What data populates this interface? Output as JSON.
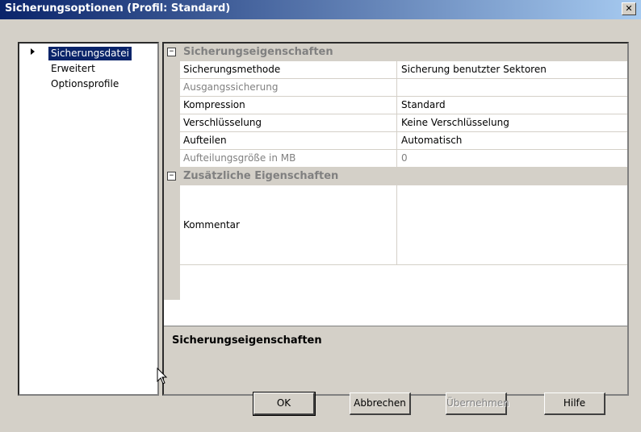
{
  "window": {
    "title": "Sicherungsoptionen (Profil: Standard)",
    "close_glyph": "✕"
  },
  "nav": {
    "items": [
      {
        "label": "Sicherungsdatei",
        "selected": true
      },
      {
        "label": "Erweitert",
        "selected": false
      },
      {
        "label": "Optionsprofile",
        "selected": false
      }
    ]
  },
  "properties": {
    "categories": [
      {
        "label": "Sicherungseigenschaften",
        "toggle": "⊟",
        "rows": [
          {
            "name": "Sicherungsmethode",
            "value": "Sicherung benutzter Sektoren",
            "enabled": true
          },
          {
            "name": "Ausgangssicherung",
            "value": "",
            "enabled": false
          },
          {
            "name": "Kompression",
            "value": "Standard",
            "enabled": true
          },
          {
            "name": "Verschlüsselung",
            "value": "Keine Verschlüsselung",
            "enabled": true
          },
          {
            "name": "Aufteilen",
            "value": "Automatisch",
            "enabled": true
          },
          {
            "name": "Aufteilungsgröße in MB",
            "value": "0",
            "enabled": false
          }
        ]
      },
      {
        "label": "Zusätzliche Eigenschaften",
        "toggle": "⊟",
        "rows": [
          {
            "name": "Kommentar",
            "value": "",
            "enabled": true
          }
        ]
      }
    ],
    "description_title": "Sicherungseigenschaften"
  },
  "buttons": {
    "ok": "OK",
    "cancel": "Abbrechen",
    "apply": "Übernehmen",
    "help": "Hilfe"
  },
  "colors": {
    "titlebar_start": "#0a246a",
    "titlebar_end": "#a6caf0",
    "selection": "#0a246a",
    "dialog_bg": "#d4d0c8"
  }
}
